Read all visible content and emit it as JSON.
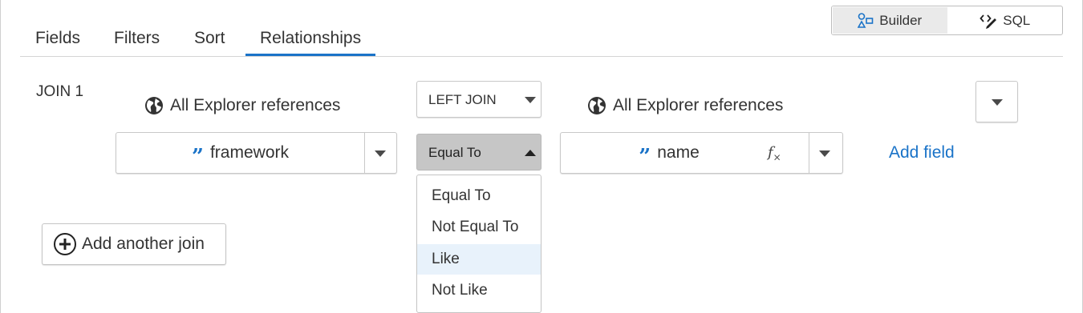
{
  "mode_toggle": {
    "builder_label": "Builder",
    "sql_label": "SQL",
    "active": "Builder"
  },
  "tabs": [
    {
      "label": "Fields"
    },
    {
      "label": "Filters"
    },
    {
      "label": "Sort"
    },
    {
      "label": "Relationships",
      "active": true
    }
  ],
  "join": {
    "label": "JOIN 1",
    "left_reference": "All Explorer references",
    "right_reference": "All Explorer references",
    "join_type": "LEFT JOIN",
    "left_field": "framework",
    "right_field": "name",
    "operator": "Equal To",
    "operator_options": [
      "Equal To",
      "Not Equal To",
      "Like",
      "Not Like"
    ],
    "highlighted_option": "Like",
    "add_field_label": "Add field"
  },
  "add_join_label": "Add another join",
  "colors": {
    "accent": "#1a73c8",
    "operator_bg": "#c6c6c6",
    "highlight_bg": "#e8f2fb"
  }
}
